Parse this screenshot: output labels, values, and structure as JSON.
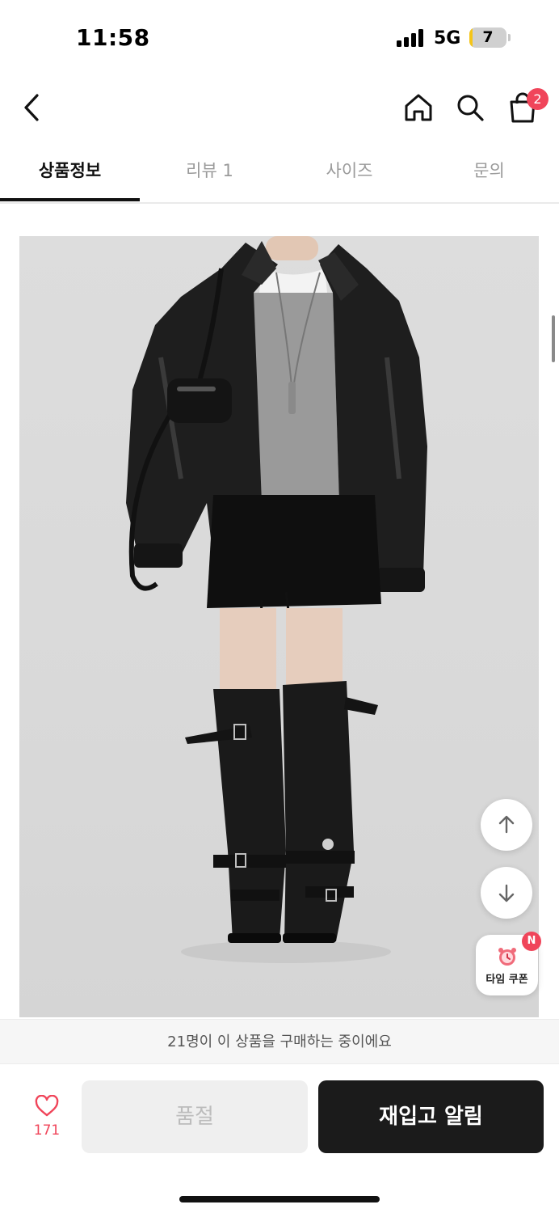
{
  "status_bar": {
    "time": "11:58",
    "network": "5G",
    "battery": "7",
    "battery_level": 0.07
  },
  "header": {
    "icons": [
      "back-icon",
      "home-icon",
      "search-icon",
      "cart-icon"
    ],
    "cart_badge": "2"
  },
  "tabs": [
    {
      "label": "상품정보",
      "active": true
    },
    {
      "label": "리뷰 1",
      "active": false
    },
    {
      "label": "사이즈",
      "active": false
    },
    {
      "label": "문의",
      "active": false
    }
  ],
  "floating": {
    "scroll_up_icon": "arrow-up-icon",
    "scroll_down_icon": "arrow-down-icon",
    "coupon_label": "타임 쿠폰",
    "coupon_badge": "N"
  },
  "purchase_banner": "21명이 이 상품을 구매하는 중이에요",
  "bottom_bar": {
    "like_count": "171",
    "soldout_label": "품절",
    "restock_label": "재입고 알림"
  },
  "colors": {
    "accent": "#f0455a",
    "primary_button": "#1b1b1b",
    "disabled_button": "#efefef"
  }
}
